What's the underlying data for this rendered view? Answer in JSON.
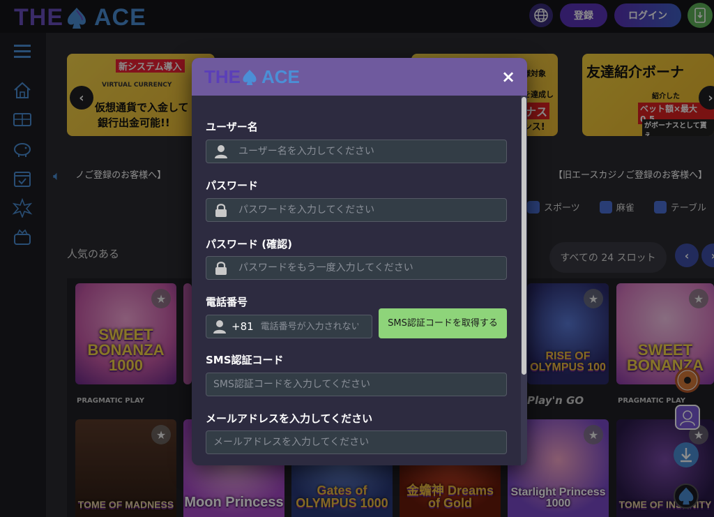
{
  "header": {
    "logo_left": "THE",
    "logo_right": "ACE",
    "register_label": "登録",
    "login_label": "ログイン"
  },
  "banners": {
    "b1_line1": "新システム導入",
    "b1_line2": "仮想通貨で入金して",
    "b1_line3": "銀行出金可能!!",
    "b1_small": "VIRTUAL CURRENCY",
    "b2_line1": "様対象",
    "b2_line2": "を達成して",
    "b2_line3": "ナス",
    "b2_line4": "ンス!",
    "b3_line1": "友達紹介ボーナ",
    "b3_line2": "紹介した",
    "b3_line3": "ベット額×最大0.5",
    "b3_line4": "がボーナスとして貰え"
  },
  "notices": {
    "left": "ノご登録のお客様へ】",
    "right": "【旧エースカジノご登録のお客様へ】"
  },
  "categories": [
    "スポーツ",
    "麻雀",
    "テーブル"
  ],
  "section": {
    "title": "人気のある",
    "all_slots": "すべての 24 スロット"
  },
  "games": [
    {
      "title": "SWEET BONANZA 1000",
      "provider": "PRAGMATIC PLAY"
    },
    {
      "title": "RISE OF OLYMPUS 100",
      "provider": "Play'n GO"
    },
    {
      "title": "SWEET BONANZA",
      "provider": "PRAGMATIC PLAY"
    },
    {
      "title": "TOME OF MADNESS"
    },
    {
      "title": "Moon Princess"
    },
    {
      "title": "Gates of OLYMPUS 1000"
    },
    {
      "title": "金蟾神 Dreams of Gold"
    },
    {
      "title": "Starlight Princess 1000"
    },
    {
      "title": "TOME OF INSANITY"
    }
  ],
  "modal": {
    "logo_left": "THE",
    "logo_right": "ACE",
    "close": "×",
    "username_label": "ユーザー名",
    "username_placeholder": "ユーザー名を入力してください",
    "password_label": "パスワード",
    "password_placeholder": "パスワードを入力してください",
    "password_confirm_label": "パスワード (確認)",
    "password_confirm_placeholder": "パスワードをもう一度入力してください",
    "phone_label": "電話番号",
    "phone_country_code": "+81",
    "phone_placeholder": "電話番号が入力されない",
    "sms_button_label": "SMS認証コードを取得する",
    "sms_code_label": "SMS認証コード",
    "sms_code_placeholder": "SMS認証コードを入力してください",
    "email_label": "メールアドレスを入力してください",
    "email_placeholder": "メールアドレスを入力してください"
  },
  "colors": {
    "brand_purple": "#5a33b8",
    "brand_blue": "#4b8fd6",
    "modal_header": "#6f5a9e",
    "sms_button": "#8ed47a"
  }
}
